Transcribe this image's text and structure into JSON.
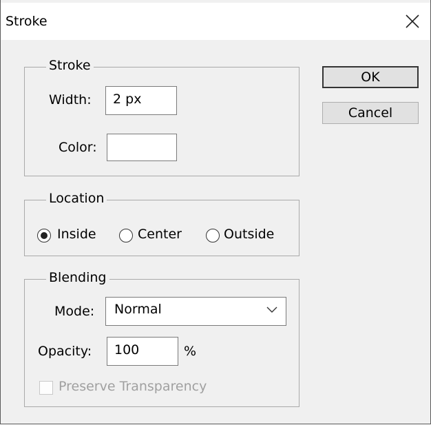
{
  "window": {
    "title": "Stroke"
  },
  "buttons": {
    "ok": "OK",
    "cancel": "Cancel"
  },
  "stroke_group": {
    "legend": "Stroke",
    "width_label": "Width:",
    "width_value": "2 px",
    "color_label": "Color:",
    "color_value": "#ffffff"
  },
  "location_group": {
    "legend": "Location",
    "options": [
      "Inside",
      "Center",
      "Outside"
    ],
    "selected": "Inside"
  },
  "blending_group": {
    "legend": "Blending",
    "mode_label": "Mode:",
    "mode_value": "Normal",
    "opacity_label": "Opacity:",
    "opacity_value": "100",
    "opacity_unit": "%",
    "preserve_label": "Preserve Transparency",
    "preserve_checked": false,
    "preserve_enabled": false
  },
  "icons": {
    "close": "close-icon",
    "dropdown": "chevron-down-icon"
  }
}
